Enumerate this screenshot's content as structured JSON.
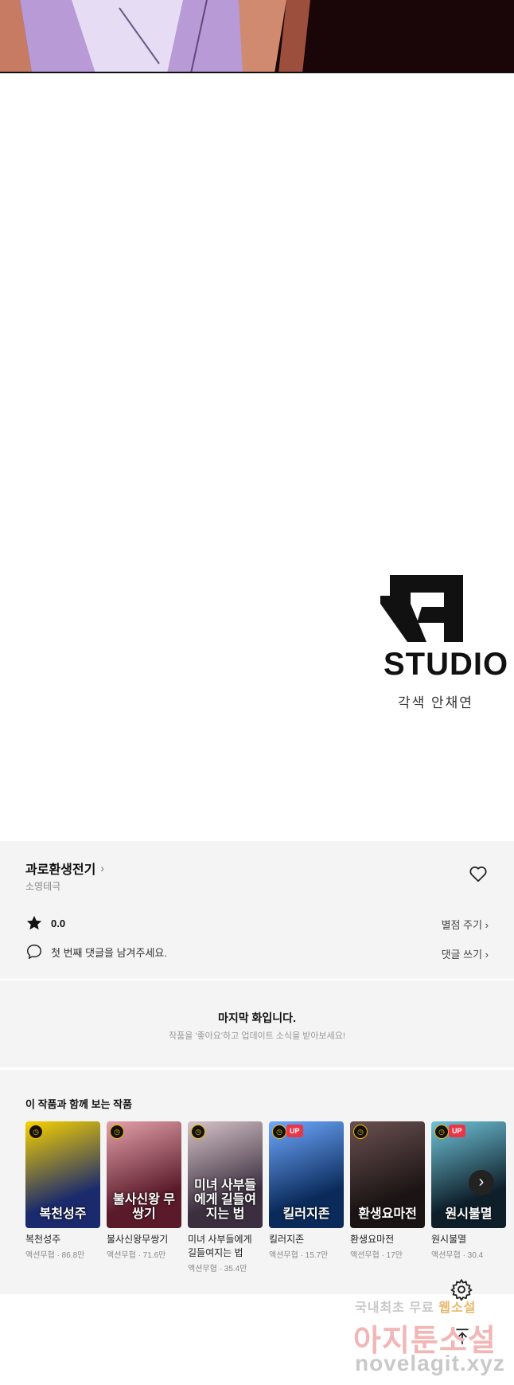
{
  "credit": {
    "studio_name": "STUDIO",
    "line": "각색 안채연"
  },
  "work": {
    "title": "과로환생전기",
    "author": "소영테극",
    "rating": "0.0",
    "rate_label": "별점 주기",
    "comment_prompt": "첫 번째 댓글을 남겨주세요.",
    "comment_label": "댓글 쓰기"
  },
  "last_notice": {
    "title": "마지막 화입니다.",
    "subtitle": "작품을 '좋아요'하고 업데이트 소식을 받아보세요!"
  },
  "recommendations": {
    "heading": "이 작품과 함께 보는 작품",
    "items": [
      {
        "title": "복천성주",
        "meta": "액션무협 · 86.8만",
        "cover_text": "복천성주",
        "up": false,
        "colors": [
          "#1a2a6c",
          "#f7d200"
        ]
      },
      {
        "title": "불사신왕무쌍기",
        "meta": "액션무협 · 71.6만",
        "cover_text": "불사신왕 무쌍기",
        "up": false,
        "colors": [
          "#5a1a2a",
          "#e2a1a9"
        ]
      },
      {
        "title": "미녀 사부들에게 길들여지는 법",
        "meta": "액션무협 · 35.4만",
        "cover_text": "미녀 사부들에게 길들여지는 법",
        "up": false,
        "colors": [
          "#3b2f3f",
          "#d6c3c8"
        ]
      },
      {
        "title": "킬러지존",
        "meta": "액션무협 · 15.7만",
        "cover_text": "킬러지존",
        "up": true,
        "colors": [
          "#0a2a5a",
          "#6fa8ff"
        ]
      },
      {
        "title": "환생요마전",
        "meta": "액션무협 · 17만",
        "cover_text": "환생요마전",
        "up": false,
        "colors": [
          "#1b1414",
          "#6a5050"
        ]
      },
      {
        "title": "원시불멸",
        "meta": "액션무협 · 30.4",
        "cover_text": "원시불멸",
        "up": true,
        "colors": [
          "#0e1f2a",
          "#6fc3d8"
        ]
      }
    ]
  },
  "icons": {
    "heart": "heart-outline-icon",
    "star": "star-icon",
    "comment": "comment-bubble-icon",
    "next": "chevron-right-icon",
    "settings": "gear-icon",
    "scroll_top": "arrow-up-icon"
  },
  "watermark": {
    "line1_prefix": "국내최초 무료",
    "line1_highlight": "웹소설",
    "line2": "아지툰소설",
    "line3": "novelagit.xyz"
  }
}
